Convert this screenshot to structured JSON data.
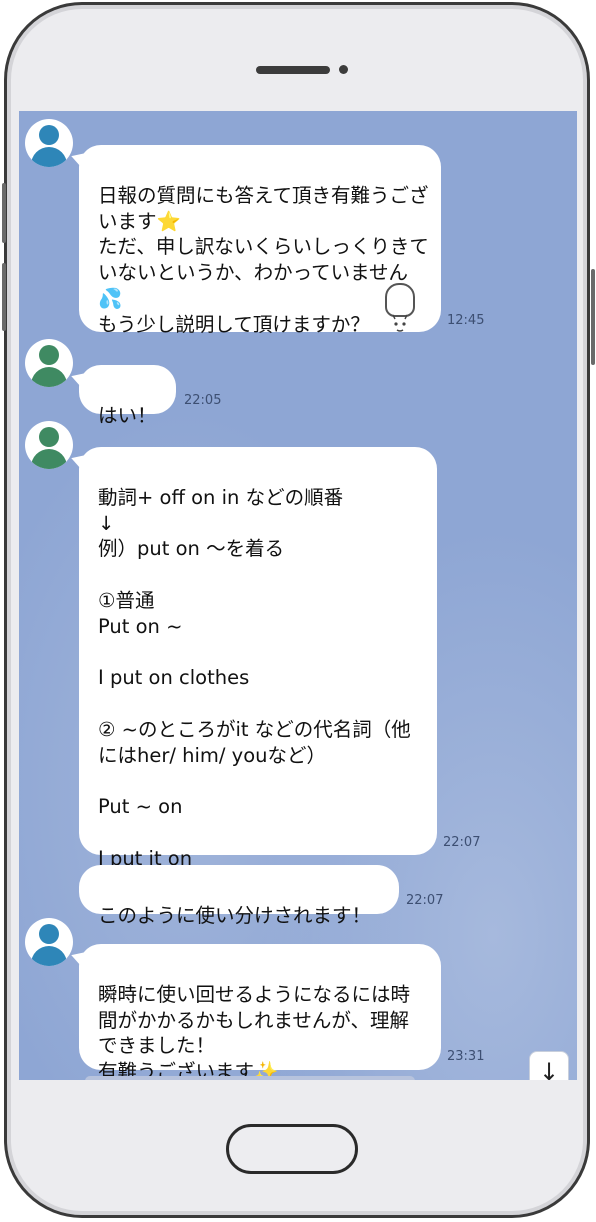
{
  "colors": {
    "chat_background": "#8ea6d4",
    "bubble": "#ffffff",
    "avatar_blue": "#2e86b8",
    "avatar_green": "#3f8a62"
  },
  "messages": [
    {
      "sender": "blue",
      "text": "日報の質問にも答えて頂き有難うございます⭐\nただ、申し訳ないくらいしっくりきていないというか、わかっていません💦\nもう少し説明して頂けますか？",
      "time": "12:45",
      "sticker_icon": "face-sticker-icon"
    },
    {
      "sender": "green",
      "text": "はい！",
      "time": "22:05"
    },
    {
      "sender": "green",
      "text": "動詞+ off on in などの順番\n↓\n例）put on 〜を着る\n\n①普通\nPut on ~\n\nI put on clothes\n\n② ~のところがit などの代名詞（他にはher/ him/ youなど）\n\nPut ~ on\n\nI put it on",
      "time": "22:07"
    },
    {
      "sender": "green",
      "text": "このように使い分けされます！",
      "time": "22:07"
    },
    {
      "sender": "blue",
      "text": "瞬時に使い回せるようになるには時間がかかるかもしれませんが、理解できました！\n有難うございます✨",
      "time": "23:31"
    }
  ],
  "scroll_down_icon": "arrow-down-icon"
}
